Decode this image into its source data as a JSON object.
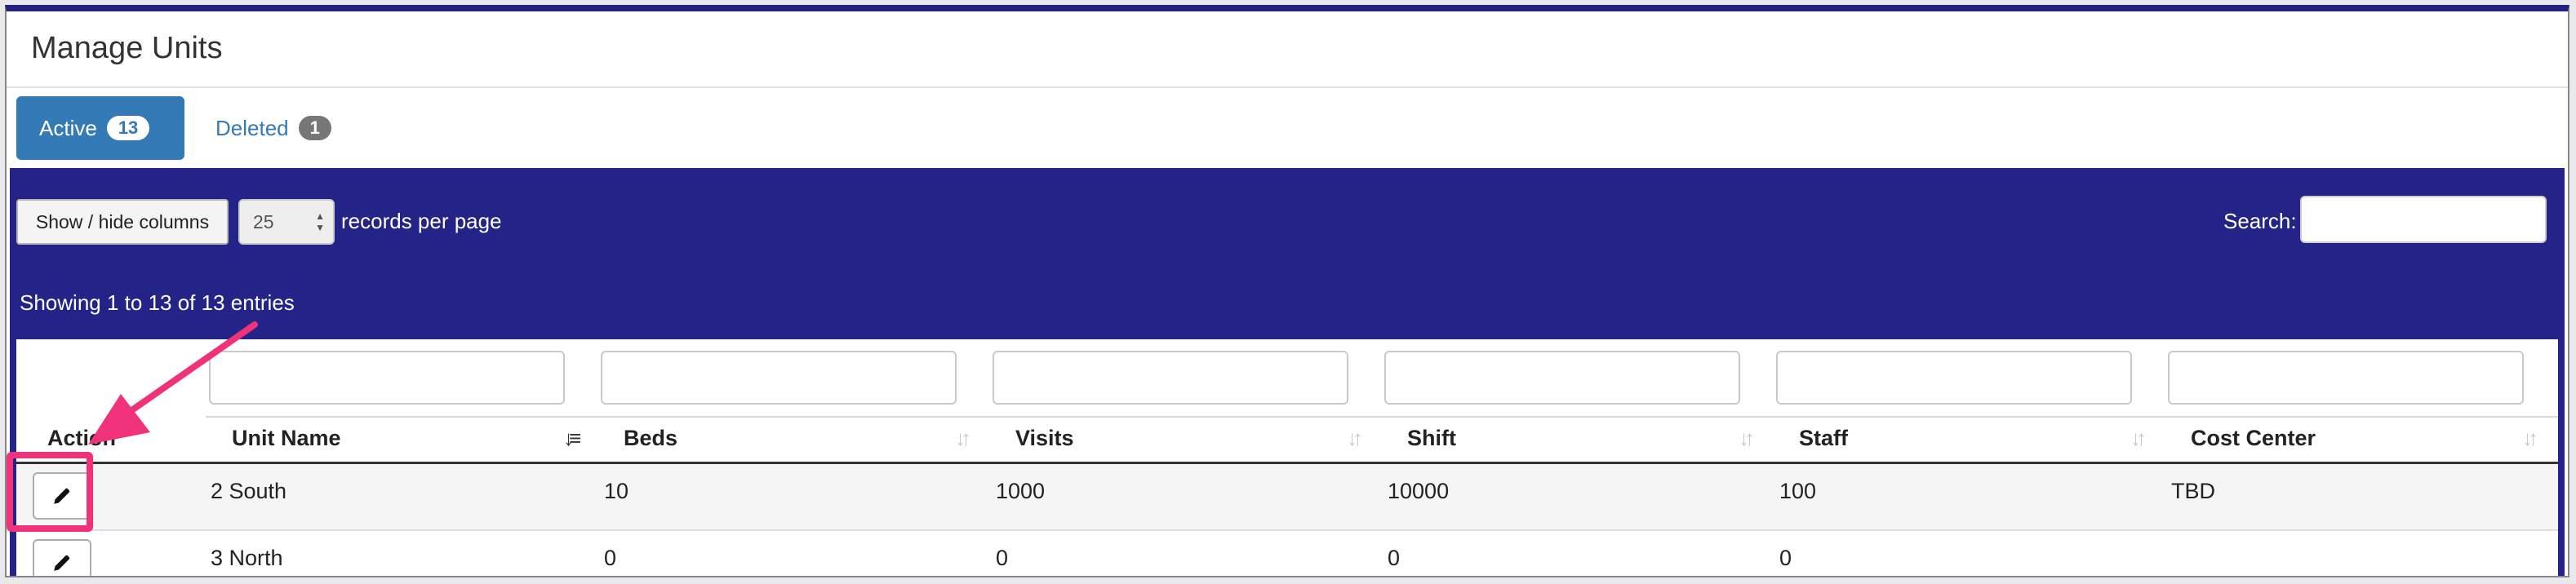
{
  "page": {
    "title": "Manage Units"
  },
  "tabs": [
    {
      "label": "Active",
      "count": "13"
    },
    {
      "label": "Deleted",
      "count": "1"
    }
  ],
  "toolbar": {
    "colvis_label": "Show / hide columns",
    "page_length": "25",
    "page_length_suffix": "records per page",
    "search_label": "Search:",
    "search_value": ""
  },
  "info": "Showing 1 to 13 of 13 entries",
  "table": {
    "columns": [
      "Action",
      "Unit Name",
      "Beds",
      "Visits",
      "Shift",
      "Staff",
      "Cost Center"
    ],
    "rows": [
      {
        "unit_name": "2 South",
        "beds": "10",
        "visits": "1000",
        "shift": "10000",
        "staff": "100",
        "cost_center": "TBD"
      },
      {
        "unit_name": "3 North",
        "beds": "0",
        "visits": "0",
        "shift": "0",
        "staff": "0",
        "cost_center": ""
      }
    ]
  },
  "icons": {
    "edit": "pencil-icon",
    "sort_active": "sort-desc-icon",
    "sort_idle": "sort-both-icon"
  },
  "colors": {
    "panel": "#232388",
    "accent": "#337ab7",
    "highlight": "#f0327a"
  }
}
